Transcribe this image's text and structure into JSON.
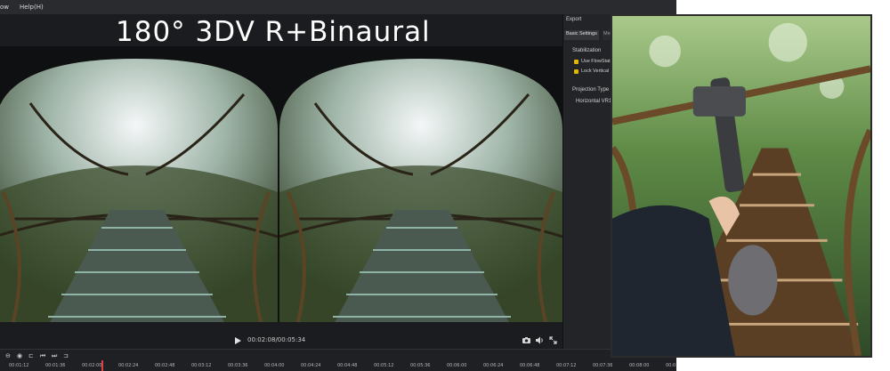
{
  "menubar": {
    "items": [
      "ow",
      "Help(H)"
    ]
  },
  "headline": "180° 3DV R+Binaural",
  "player": {
    "timecode": "00:02:08/00:05:34"
  },
  "export_panel": {
    "title": "Export",
    "tabs": [
      "Basic Settings",
      "Med"
    ],
    "stabilization_heading": "Stabilization",
    "options": [
      "Use FlowStat",
      "Lock Vertical"
    ],
    "projection_heading": "Projection Type",
    "projection_value": "Horizontal VR1"
  },
  "timeline": {
    "ticks": [
      "00:01:12",
      "00:01:36",
      "00:02:00",
      "00:02:24",
      "00:02:48",
      "00:03:12",
      "00:03:36",
      "00:04:00",
      "00:04:24",
      "00:04:48",
      "00:05:12",
      "00:05:36",
      "00:06:00",
      "00:06:24",
      "00:06:48",
      "00:07:12",
      "00:07:36",
      "00:08:00",
      "00:0"
    ]
  },
  "colors": {
    "accent": "#e0b800",
    "playhead": "#e04040",
    "background": "#1b1c1f"
  }
}
